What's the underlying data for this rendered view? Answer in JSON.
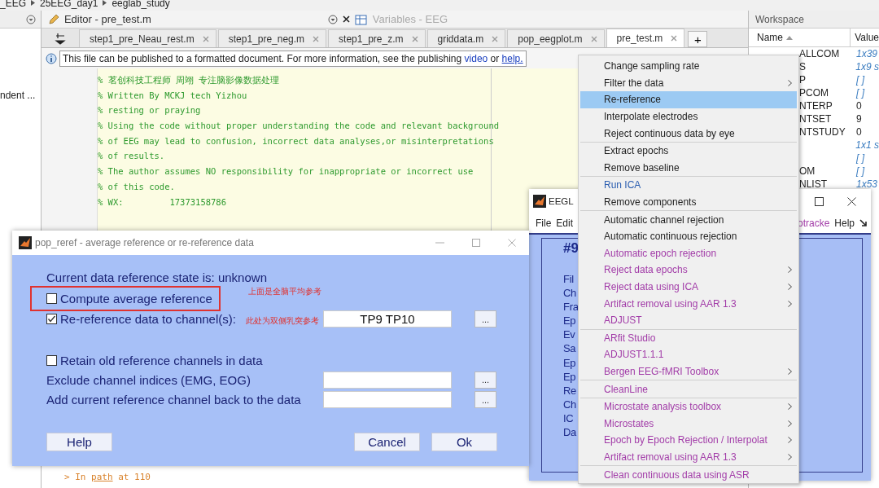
{
  "breadcrumb": [
    "_EEG",
    "25EEG_day1",
    "eeglab_study"
  ],
  "left_panel": {
    "item": "ndent ..."
  },
  "editor": {
    "title": "Editor - pre_test.m",
    "variables_title": "Variables - EEG",
    "tabs": [
      {
        "label": "step1_pre_Neau_rest.m",
        "selected": false
      },
      {
        "label": "step1_pre_neg.m",
        "selected": false
      },
      {
        "label": "step1_pre_z.m",
        "selected": false
      },
      {
        "label": "griddata.m",
        "selected": false
      },
      {
        "label": "pop_eegplot.m",
        "selected": false
      },
      {
        "label": "pre_test.m",
        "selected": true
      }
    ],
    "new_tab": "+",
    "info": {
      "text": "This file can be published to a formatted document. For more information, see the publishing",
      "link_1": "video",
      "middle": "or",
      "link_2": "help."
    },
    "code_lines": [
      "% 茗创科技工程师 周翊 专注脑影像数据处理",
      "% Written By MCKJ tech Yizhou",
      "% resting or praying",
      "% Using the code without proper understanding the code and relevant background",
      "% of EEG may lead to confusion, incorrect data analyses,or misinterpretations",
      "% of results.",
      "% The author assumes NO responsibility for inappropriate or incorrect use",
      "% of this code.",
      "% WX:         17373158786"
    ],
    "command_line": {
      "prompt": ">",
      "before": "In",
      "link": "path",
      "after": "at 110"
    }
  },
  "workspace": {
    "title": "Workspace",
    "columns": [
      "Name",
      "Value"
    ],
    "rows": [
      {
        "name": "ALLCOM",
        "value": "1x39",
        "kind": "struct"
      },
      {
        "name": "S",
        "value": "1x9 s",
        "kind": "struct"
      },
      {
        "name": "P",
        "value": "[ ]",
        "kind": "struct"
      },
      {
        "name": "PCOM",
        "value": "[ ]",
        "kind": "struct"
      },
      {
        "name": "NTERP",
        "value": "0",
        "kind": "number"
      },
      {
        "name": "NTSET",
        "value": "9",
        "kind": "number"
      },
      {
        "name": "NTSTUDY",
        "value": "0",
        "kind": "number"
      },
      {
        "value": "1x1 s",
        "kind": "struct"
      },
      {
        "value": "[ ]",
        "kind": "struct"
      },
      {
        "name": "OM",
        "value": "[ ]",
        "kind": "struct"
      },
      {
        "name": "NLIST",
        "value": "1x53",
        "kind": "struct"
      }
    ]
  },
  "eeglab": {
    "title": "EEGL",
    "menu_left": [
      "File",
      "Edit"
    ],
    "menu_right": [
      "otracke",
      "Help"
    ],
    "dataset": "#9",
    "labels": [
      "Fil",
      "Ch",
      "Fra",
      "Ep",
      "Ev",
      "Sa",
      "Ep",
      "Ep",
      "Re",
      "Ch",
      "IC",
      "Da"
    ]
  },
  "tools_menu": {
    "groups": [
      [
        {
          "label": "Change sampling rate",
          "submenu": false,
          "selected": false,
          "color": "#222222"
        },
        {
          "label": "Filter the data",
          "submenu": true,
          "selected": false,
          "color": "#222222"
        },
        {
          "label": "Re-reference",
          "submenu": false,
          "selected": true,
          "color": "#222222"
        },
        {
          "label": "Interpolate electrodes",
          "submenu": false,
          "selected": false,
          "color": "#222222"
        },
        {
          "label": "Reject continuous data by eye",
          "submenu": false,
          "selected": false,
          "color": "#222222"
        }
      ],
      [
        {
          "label": "Extract epochs",
          "submenu": false,
          "selected": false,
          "color": "#222222"
        },
        {
          "label": "Remove baseline",
          "submenu": false,
          "selected": false,
          "color": "#222222"
        }
      ],
      [
        {
          "label": "Run ICA",
          "submenu": false,
          "selected": false,
          "color": "#2a5db0"
        },
        {
          "label": "Remove components",
          "submenu": false,
          "selected": false,
          "color": "#222222"
        }
      ],
      [
        {
          "label": "Automatic channel rejection",
          "submenu": false,
          "selected": false,
          "color": "#222222"
        },
        {
          "label": "Automatic continuous rejection",
          "submenu": false,
          "selected": false,
          "color": "#222222"
        },
        {
          "label": "Automatic epoch rejection",
          "submenu": false,
          "selected": false,
          "color": "#a23ca8"
        },
        {
          "label": "Reject data epochs",
          "submenu": true,
          "selected": false,
          "color": "#a23ca8"
        },
        {
          "label": "Reject data using ICA",
          "submenu": true,
          "selected": false,
          "color": "#a23ca8"
        },
        {
          "label": "Artifact removal using AAR 1.3",
          "submenu": true,
          "selected": false,
          "color": "#a23ca8"
        },
        {
          "label": "ADJUST",
          "submenu": false,
          "selected": false,
          "color": "#a23ca8"
        }
      ],
      [
        {
          "label": "ARfit Studio",
          "submenu": false,
          "selected": false,
          "color": "#a23ca8"
        },
        {
          "label": "ADJUST1.1.1",
          "submenu": false,
          "selected": false,
          "color": "#a23ca8"
        },
        {
          "label": "Bergen EEG-fMRI Toolbox",
          "submenu": true,
          "selected": false,
          "color": "#a23ca8"
        }
      ],
      [
        {
          "label": "CleanLine",
          "submenu": false,
          "selected": false,
          "color": "#a23ca8"
        }
      ],
      [
        {
          "label": "Microstate analysis toolbox",
          "submenu": true,
          "selected": false,
          "color": "#a23ca8"
        },
        {
          "label": "Microstates",
          "submenu": true,
          "selected": false,
          "color": "#a23ca8"
        },
        {
          "label": "Epoch by Epoch Rejection / Interpolat",
          "submenu": true,
          "selected": false,
          "color": "#a23ca8"
        },
        {
          "label": "Artifact removal using AAR 1.3",
          "submenu": true,
          "selected": false,
          "color": "#a23ca8"
        }
      ],
      [
        {
          "label": "Clean continuous data using ASR",
          "submenu": false,
          "selected": false,
          "color": "#a23ca8"
        }
      ]
    ]
  },
  "dialog": {
    "title": "pop_reref - average reference or re-reference data",
    "rows": [
      {
        "kind": "text",
        "label": "Current data reference state is: unknown"
      },
      {
        "kind": "checkbox",
        "label": "Compute average reference",
        "checked": false,
        "highlighted": true,
        "note": "上面是全脑平均参考"
      },
      {
        "kind": "checkbox",
        "label": "Re-reference data to channel(s):",
        "checked": true,
        "highlighted": false,
        "note": "此处为双侧乳突参考",
        "value": "TP9 TP10"
      },
      {
        "kind": "checkbox",
        "label": "Retain old reference channels in data",
        "checked": false,
        "highlighted": false
      },
      {
        "kind": "field",
        "label": "Exclude channel indices (EMG, EOG)",
        "input": true
      },
      {
        "kind": "field",
        "label": "Add current reference channel back to the data",
        "input": true
      }
    ],
    "browse": "...",
    "buttons": {
      "help": "Help",
      "cancel": "Cancel",
      "ok": "Ok"
    }
  }
}
